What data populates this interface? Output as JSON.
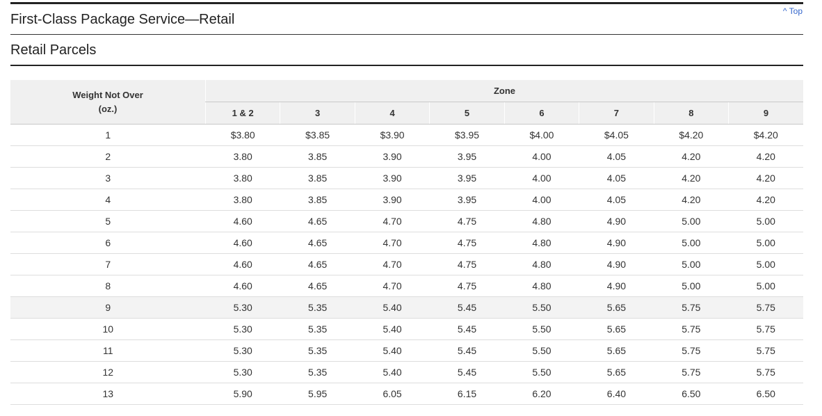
{
  "header": {
    "top_link": "^ Top",
    "page_title": "First-Class Package Service—Retail",
    "section_title": "Retail Parcels"
  },
  "table": {
    "weight_header_line1": "Weight Not Over",
    "weight_header_line2": "(oz.)",
    "zone_header": "Zone",
    "zones": [
      "1 & 2",
      "3",
      "4",
      "5",
      "6",
      "7",
      "8",
      "9"
    ],
    "rows": [
      {
        "weight": "1",
        "prices": [
          "$3.80",
          "$3.85",
          "$3.90",
          "$3.95",
          "$4.00",
          "$4.05",
          "$4.20",
          "$4.20"
        ]
      },
      {
        "weight": "2",
        "prices": [
          "3.80",
          "3.85",
          "3.90",
          "3.95",
          "4.00",
          "4.05",
          "4.20",
          "4.20"
        ]
      },
      {
        "weight": "3",
        "prices": [
          "3.80",
          "3.85",
          "3.90",
          "3.95",
          "4.00",
          "4.05",
          "4.20",
          "4.20"
        ]
      },
      {
        "weight": "4",
        "prices": [
          "3.80",
          "3.85",
          "3.90",
          "3.95",
          "4.00",
          "4.05",
          "4.20",
          "4.20"
        ]
      },
      {
        "weight": "5",
        "prices": [
          "4.60",
          "4.65",
          "4.70",
          "4.75",
          "4.80",
          "4.90",
          "5.00",
          "5.00"
        ]
      },
      {
        "weight": "6",
        "prices": [
          "4.60",
          "4.65",
          "4.70",
          "4.75",
          "4.80",
          "4.90",
          "5.00",
          "5.00"
        ]
      },
      {
        "weight": "7",
        "prices": [
          "4.60",
          "4.65",
          "4.70",
          "4.75",
          "4.80",
          "4.90",
          "5.00",
          "5.00"
        ]
      },
      {
        "weight": "8",
        "prices": [
          "4.60",
          "4.65",
          "4.70",
          "4.75",
          "4.80",
          "4.90",
          "5.00",
          "5.00"
        ]
      },
      {
        "weight": "9",
        "prices": [
          "5.30",
          "5.35",
          "5.40",
          "5.45",
          "5.50",
          "5.65",
          "5.75",
          "5.75"
        ]
      },
      {
        "weight": "10",
        "prices": [
          "5.30",
          "5.35",
          "5.40",
          "5.45",
          "5.50",
          "5.65",
          "5.75",
          "5.75"
        ]
      },
      {
        "weight": "11",
        "prices": [
          "5.30",
          "5.35",
          "5.40",
          "5.45",
          "5.50",
          "5.65",
          "5.75",
          "5.75"
        ]
      },
      {
        "weight": "12",
        "prices": [
          "5.30",
          "5.35",
          "5.40",
          "5.45",
          "5.50",
          "5.65",
          "5.75",
          "5.75"
        ]
      },
      {
        "weight": "13",
        "prices": [
          "5.90",
          "5.95",
          "6.05",
          "6.15",
          "6.20",
          "6.40",
          "6.50",
          "6.50"
        ]
      }
    ]
  },
  "colors": {
    "header_bg": "#f0f0f0",
    "highlight_row_bg": "#f3f3f3",
    "link": "#3366cc"
  }
}
